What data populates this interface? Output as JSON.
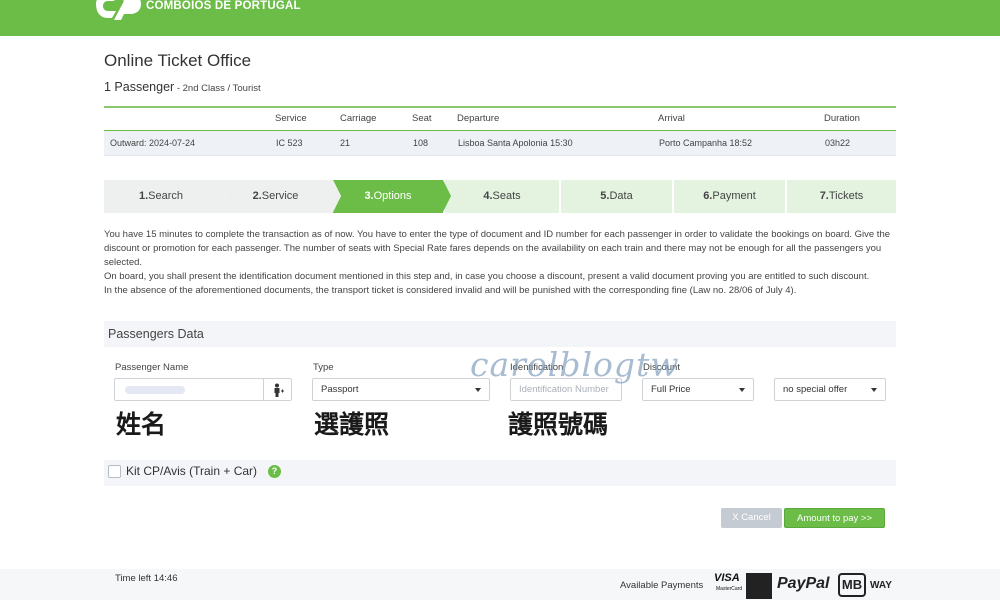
{
  "header": {
    "brand": "COMBOIOS DE PORTUGAL"
  },
  "page": {
    "title": "Online Ticket Office",
    "passengers": "1 Passenger",
    "class_info": " - 2nd Class / Tourist"
  },
  "trip_table": {
    "headers": {
      "service": "Service",
      "carriage": "Carriage",
      "seat": "Seat",
      "departure": "Departure",
      "arrival": "Arrival",
      "duration": "Duration"
    },
    "row": {
      "direction": "Outward: 2024-07-24",
      "service": "IC 523",
      "carriage": "21",
      "seat": "108",
      "departure": "Lisboa Santa Apolonia 15:30",
      "arrival": "Porto Campanha 18:52",
      "duration": "03h22"
    }
  },
  "steps": [
    {
      "num": "1.",
      "label": "Search",
      "state": "done"
    },
    {
      "num": "2.",
      "label": "Service",
      "state": "done"
    },
    {
      "num": "3.",
      "label": "Options",
      "state": "active"
    },
    {
      "num": "4.",
      "label": "Seats",
      "state": "todo"
    },
    {
      "num": "5.",
      "label": "Data",
      "state": "todo"
    },
    {
      "num": "6.",
      "label": "Payment",
      "state": "todo"
    },
    {
      "num": "7.",
      "label": "Tickets",
      "state": "todo"
    }
  ],
  "info": {
    "p1": "You have 15 minutes to complete the transaction as of now. You have to enter the type of document and ID number for each passenger in order to validate the bookings on board. Give the discount or promotion for each passenger. The number of seats with Special Rate fares depends on the availability on each train and there may not be enough for all the passengers you selected.",
    "p2": "On board, you shall present the identification document mentioned in this step and, in case you choose a discount, present a valid document proving you are entitled to such discount.",
    "p3": "In the absence of the aforementioned documents, the transport ticket is considered invalid and will be punished with the corresponding fine (Law no. 28/06 of July 4)."
  },
  "passengers_data": {
    "title": "Passengers Data",
    "labels": {
      "name": "Passenger Name",
      "type": "Type",
      "identification": "Identification",
      "discount": "Discount"
    },
    "type_value": "Passport",
    "identification_placeholder": "Identification Number",
    "discount_value": "Full Price",
    "offer_value": "no special offer"
  },
  "annotations": {
    "name": "姓名",
    "type": "選護照",
    "id": "護照號碼",
    "watermark": "carolblogtw"
  },
  "kit": {
    "label": "Kit CP/Avis (Train + Car)",
    "help": "?"
  },
  "buttons": {
    "cancel": "X Cancel",
    "pay": "Amount to pay >>"
  },
  "footer": {
    "time_left": "Time left 14:46",
    "available_payments": "Available Payments",
    "logos": {
      "visa": "VISA",
      "visa_sub": "MasterCard",
      "paypal": "PayPal",
      "mb": "MB",
      "way": "WAY"
    }
  },
  "colors": {
    "brand_green": "#6cbd48",
    "step_todo": "#e3f3e0",
    "step_done": "#eef0ef"
  }
}
